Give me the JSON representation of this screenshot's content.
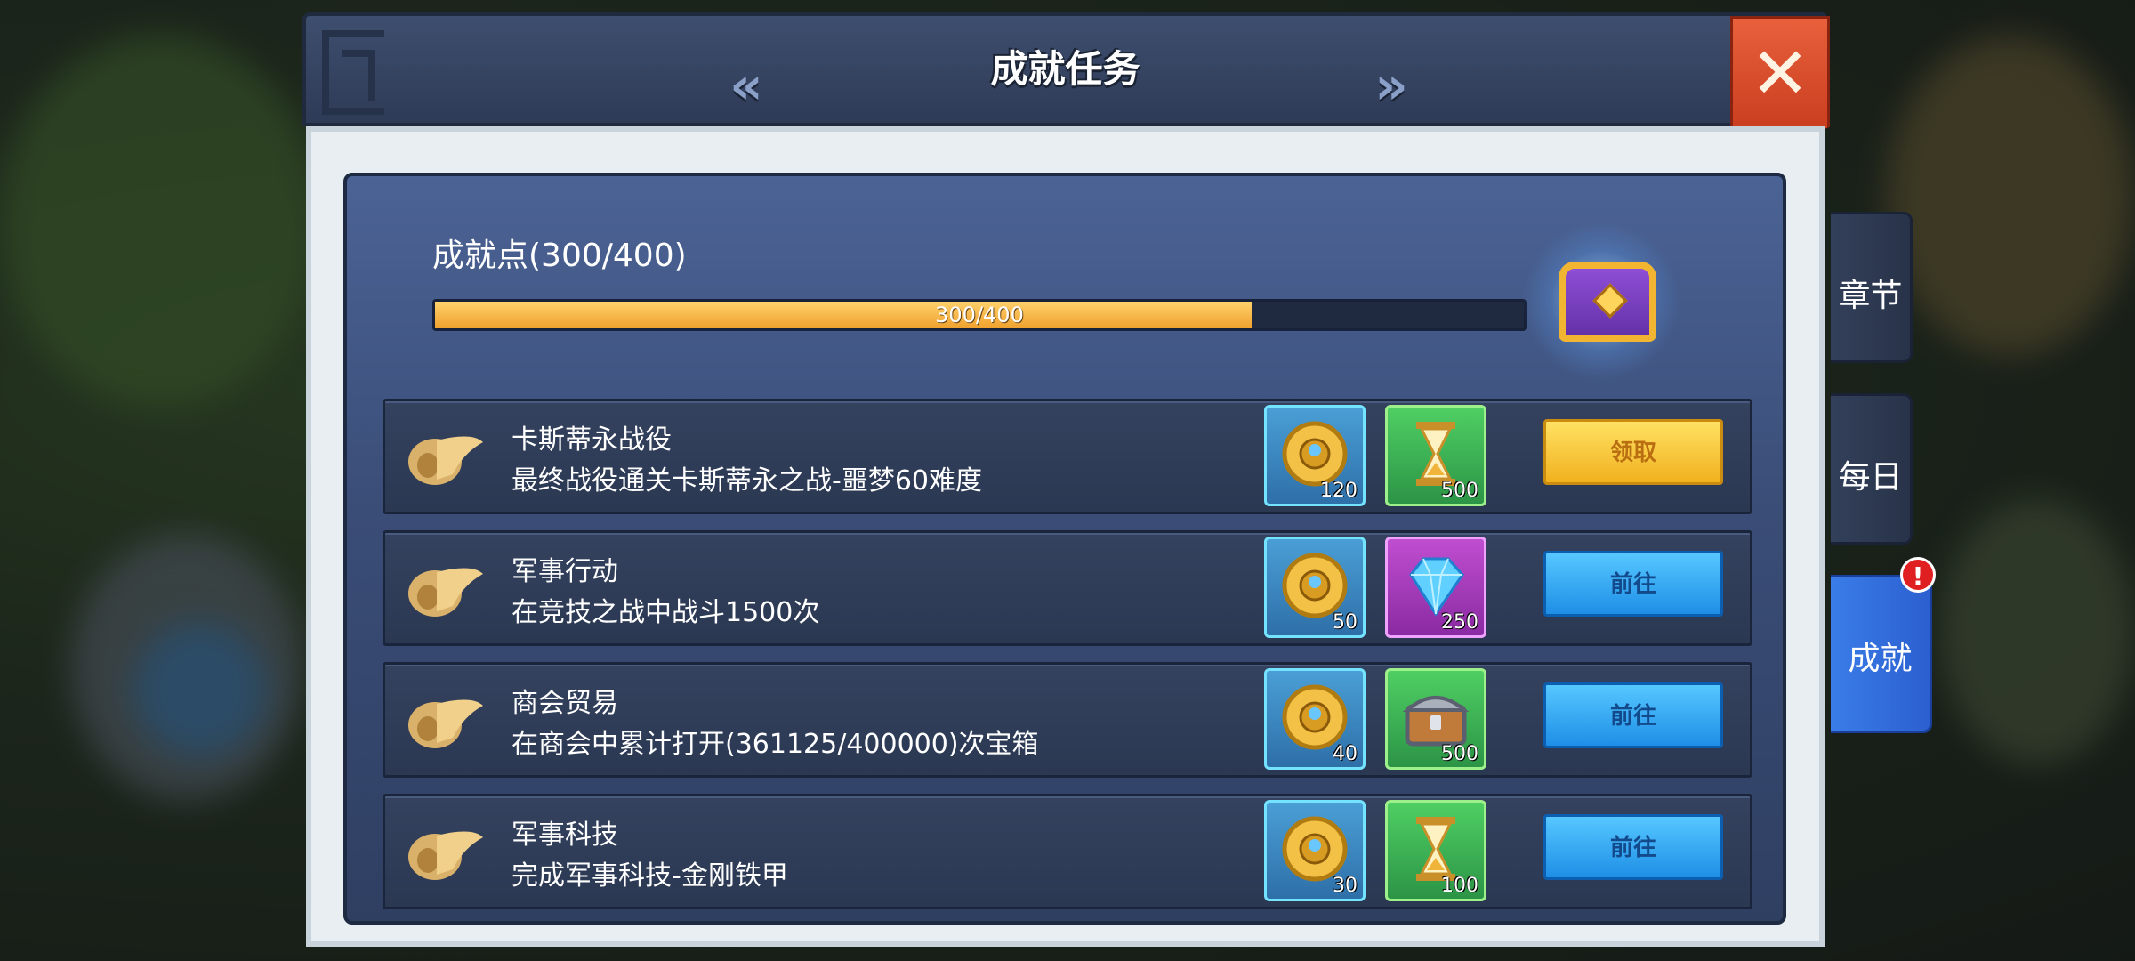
{
  "header": {
    "title": "成就任务",
    "prev_icon": "double-chevron-left",
    "next_icon": "double-chevron-right",
    "close_icon": "close-x"
  },
  "achievement": {
    "label": "成就点(300/400)",
    "progress_text": "300/400",
    "current": 300,
    "total": 400,
    "progress_fraction": 0.75
  },
  "tasks": [
    {
      "title": "卡斯蒂永战役",
      "desc": "最终战役通关卡斯蒂永之战-噩梦60难度",
      "rewards": [
        {
          "icon": "gold-medal",
          "count": "120"
        },
        {
          "icon": "hourglass",
          "count": "500"
        }
      ],
      "button": "领取",
      "button_type": "claim"
    },
    {
      "title": "军事行动",
      "desc": "在竞技之战中战斗1500次",
      "rewards": [
        {
          "icon": "gold-medal",
          "count": "50"
        },
        {
          "icon": "blue-diamond",
          "count": "250"
        }
      ],
      "button": "前往",
      "button_type": "go"
    },
    {
      "title": "商会贸易",
      "desc": "在商会中累计打开(361125/400000)次宝箱",
      "rewards": [
        {
          "icon": "gold-medal",
          "count": "40"
        },
        {
          "icon": "iron-chest",
          "count": "500"
        }
      ],
      "button": "前往",
      "button_type": "go"
    },
    {
      "title": "军事科技",
      "desc": "完成军事科技-金刚铁甲",
      "rewards": [
        {
          "icon": "gold-medal",
          "count": "30"
        },
        {
          "icon": "hourglass",
          "count": "100"
        }
      ],
      "button": "前往",
      "button_type": "go"
    }
  ],
  "side_tabs": [
    {
      "label": "章节",
      "active": false
    },
    {
      "label": "每日",
      "active": false
    },
    {
      "label": "成就",
      "active": true,
      "badge": "!"
    }
  ]
}
